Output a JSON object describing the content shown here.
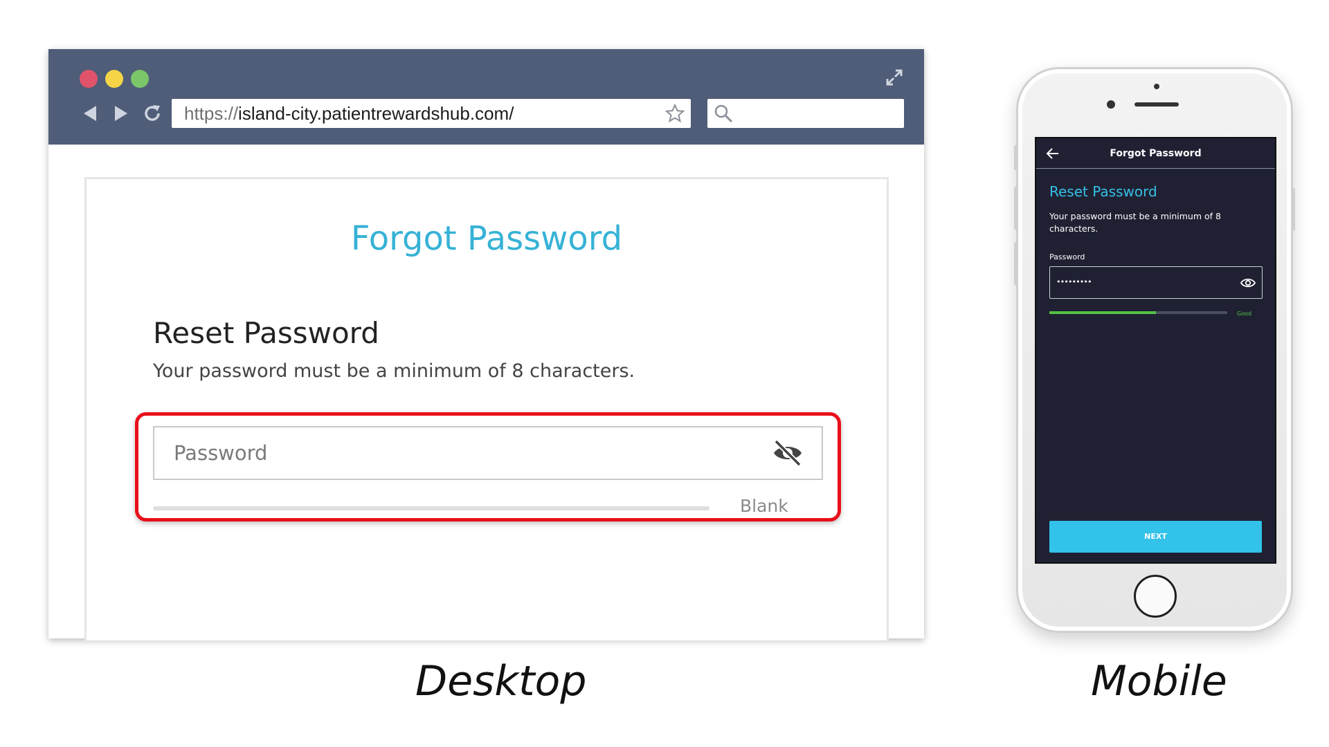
{
  "desktop": {
    "url": {
      "scheme": "https://",
      "host": "island-city.patientrewardshub.com/"
    },
    "page": {
      "heading": "Forgot Password",
      "title": "Reset Password",
      "description": "Your password must be a minimum of 8 characters.",
      "password_placeholder": "Password",
      "strength_label": "Blank",
      "strength_fraction": 0
    },
    "caption": "Desktop"
  },
  "mobile": {
    "header_title": "Forgot Password",
    "title": "Reset Password",
    "description": "Your password must be a minimum of 8 characters.",
    "field_label": "Password",
    "password_value": "•••••••••",
    "strength_label": "Good",
    "strength_fraction": 0.6,
    "next_label": "NEXT",
    "caption": "Mobile"
  },
  "colors": {
    "accent": "#36b2d6",
    "highlight": "#e8101a",
    "mobile_bg": "#1f2133",
    "mobile_button": "#32c2ea",
    "strength_good": "#55c346"
  },
  "icons": {
    "window_controls": [
      "close-dot",
      "minimize-dot",
      "zoom-dot"
    ],
    "browser": [
      "back-arrow-icon",
      "forward-arrow-icon",
      "reload-icon",
      "star-icon",
      "search-icon",
      "expand-icon"
    ],
    "desktop_field": "eye-off-icon",
    "mobile": [
      "back-arrow-icon",
      "eye-icon"
    ]
  }
}
